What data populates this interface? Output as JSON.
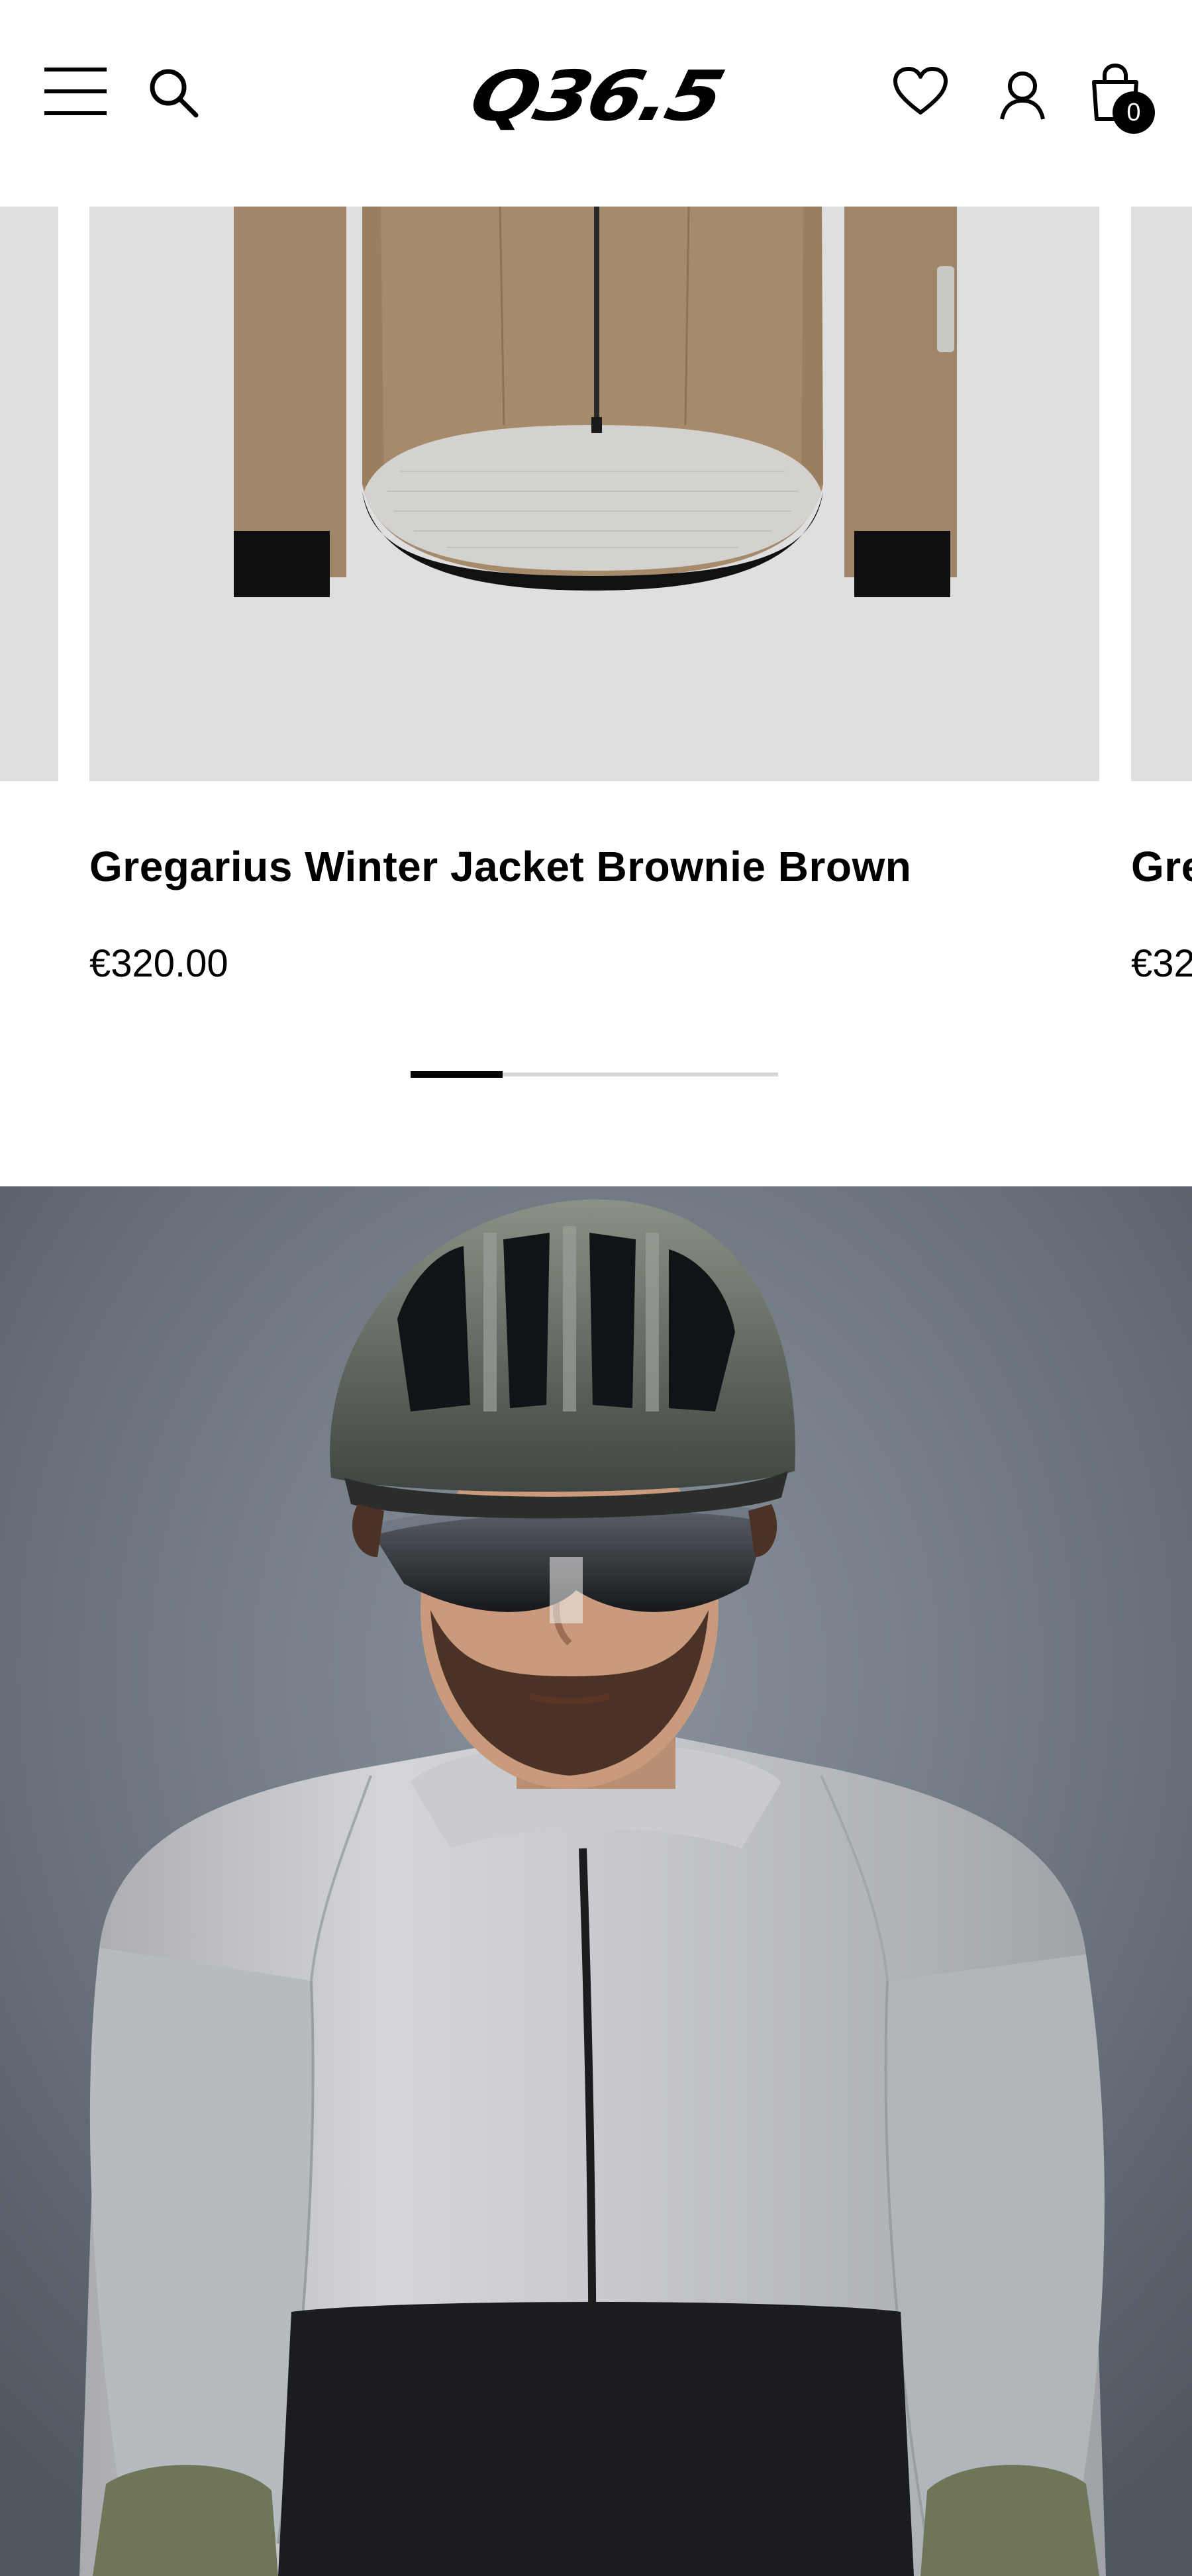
{
  "header": {
    "logo_text": "Q36.5",
    "cart_count": "0"
  },
  "carousel": {
    "progress": 0.25,
    "slides": [
      {
        "title": "Gregarius Winter Jacket Brownie Brown",
        "price": "€320.00"
      },
      {
        "title": "Gre",
        "price": "€32"
      }
    ]
  },
  "colors": {
    "jacket_brown": "#a08668",
    "image_bg": "#dfdfdf",
    "accent": "#000000"
  }
}
